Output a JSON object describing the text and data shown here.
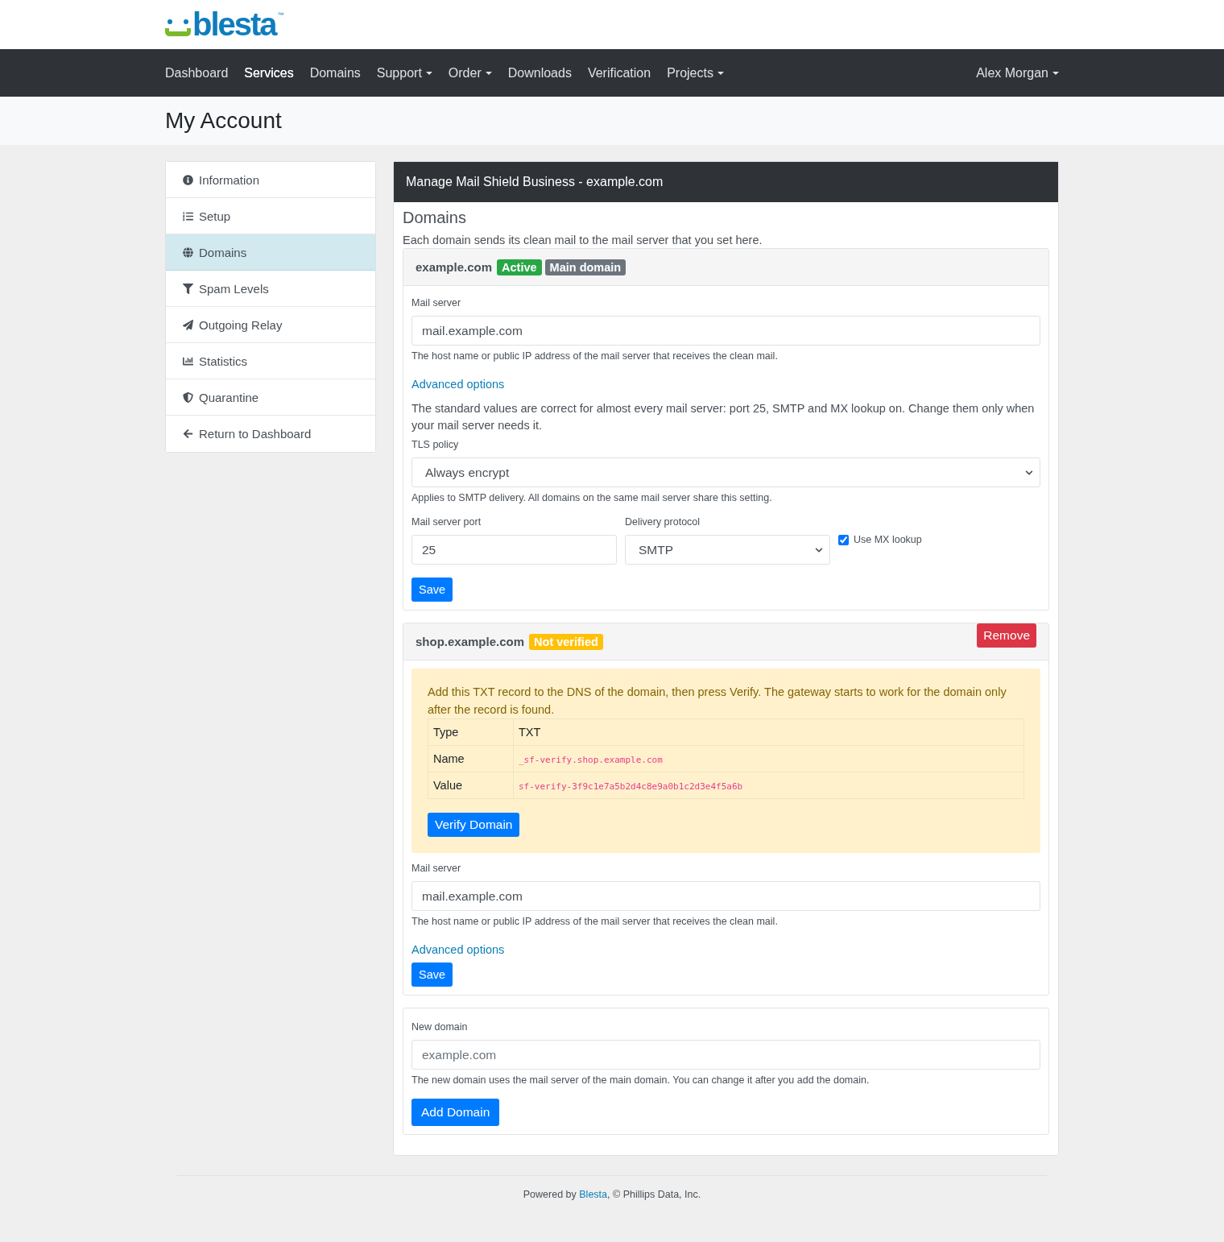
{
  "logo": {
    "text": "blesta",
    "mark": "™"
  },
  "nav": {
    "items": [
      {
        "label": "Dashboard",
        "selected": false,
        "dropdown": false
      },
      {
        "label": "Services",
        "selected": true,
        "dropdown": false
      },
      {
        "label": "Domains",
        "selected": false,
        "dropdown": false
      },
      {
        "label": "Support",
        "selected": false,
        "dropdown": true
      },
      {
        "label": "Order",
        "selected": false,
        "dropdown": true
      },
      {
        "label": "Downloads",
        "selected": false,
        "dropdown": false
      },
      {
        "label": "Verification",
        "selected": false,
        "dropdown": false
      },
      {
        "label": "Projects",
        "selected": false,
        "dropdown": true
      }
    ],
    "user": {
      "label": "Alex Morgan",
      "dropdown": true
    }
  },
  "page_title": "My Account",
  "sidebar": {
    "items": [
      {
        "label": "Information",
        "selected": false
      },
      {
        "label": "Setup",
        "selected": false
      },
      {
        "label": "Domains",
        "selected": true
      },
      {
        "label": "Spam Levels",
        "selected": false
      },
      {
        "label": "Outgoing Relay",
        "selected": false
      },
      {
        "label": "Statistics",
        "selected": false
      },
      {
        "label": "Quarantine",
        "selected": false
      },
      {
        "label": "Return to Dashboard",
        "selected": false
      }
    ]
  },
  "panel": {
    "title": "Manage Mail Shield Business - example.com",
    "heading": "Domains",
    "intro": "Each domain sends its clean mail to the mail server that you set here.",
    "domains": [
      {
        "name": "example.com",
        "badges": [
          {
            "label": "Active",
            "color": "#28a745"
          },
          {
            "label": "Main domain",
            "color": "#6c757d"
          }
        ],
        "mail_server": {
          "label": "Mail server",
          "value": "mail.example.com",
          "help": "The host name or public IP address of the mail server that receives the clean mail."
        },
        "advanced_link": "Advanced options",
        "advanced": {
          "text": "The standard values are correct for almost every mail server: port 25, SMTP and MX lookup on. Change them only when your mail server needs it.",
          "tls": {
            "label": "TLS policy",
            "value": "Always encrypt",
            "help": "Applies to SMTP delivery. All domains on the same mail server share this setting."
          },
          "port": {
            "label": "Mail server port",
            "value": "25"
          },
          "protocol": {
            "label": "Delivery protocol",
            "value": "SMTP"
          },
          "mx_lookup": {
            "label": "Use MX lookup",
            "checked": true
          }
        },
        "save": "Save"
      },
      {
        "name": "shop.example.com",
        "badges": [
          {
            "label": "Not verified",
            "color": "#ffc107"
          }
        ],
        "remove": "Remove",
        "notice": {
          "text": "Add this TXT record to the DNS of the domain, then press Verify. The gateway starts to work for the domain only after the record is found.",
          "records": [
            {
              "label": "Type",
              "value": "TXT",
              "kind": "plain"
            },
            {
              "label": "Name",
              "value": "_sf-verify.shop.example.com",
              "kind": "code"
            },
            {
              "label": "Value",
              "value": "sf-verify-3f9c1e7a5b2d4c8e9a0b1c2d3e4f5a6b",
              "kind": "code"
            }
          ],
          "button": "Verify Domain"
        },
        "mail_server": {
          "label": "Mail server",
          "value": "mail.example.com",
          "help": "The host name or public IP address of the mail server that receives the clean mail."
        },
        "advanced_link": "Advanced options",
        "save": "Save"
      }
    ],
    "new_domain": {
      "label": "New domain",
      "placeholder": "example.com",
      "help": "The new domain uses the mail server of the main domain. You can change it after you add the domain.",
      "button": "Add Domain"
    }
  },
  "footer": {
    "prefix": "Powered by ",
    "link": "Blesta",
    "suffix": ", © Phillips Data, Inc."
  }
}
